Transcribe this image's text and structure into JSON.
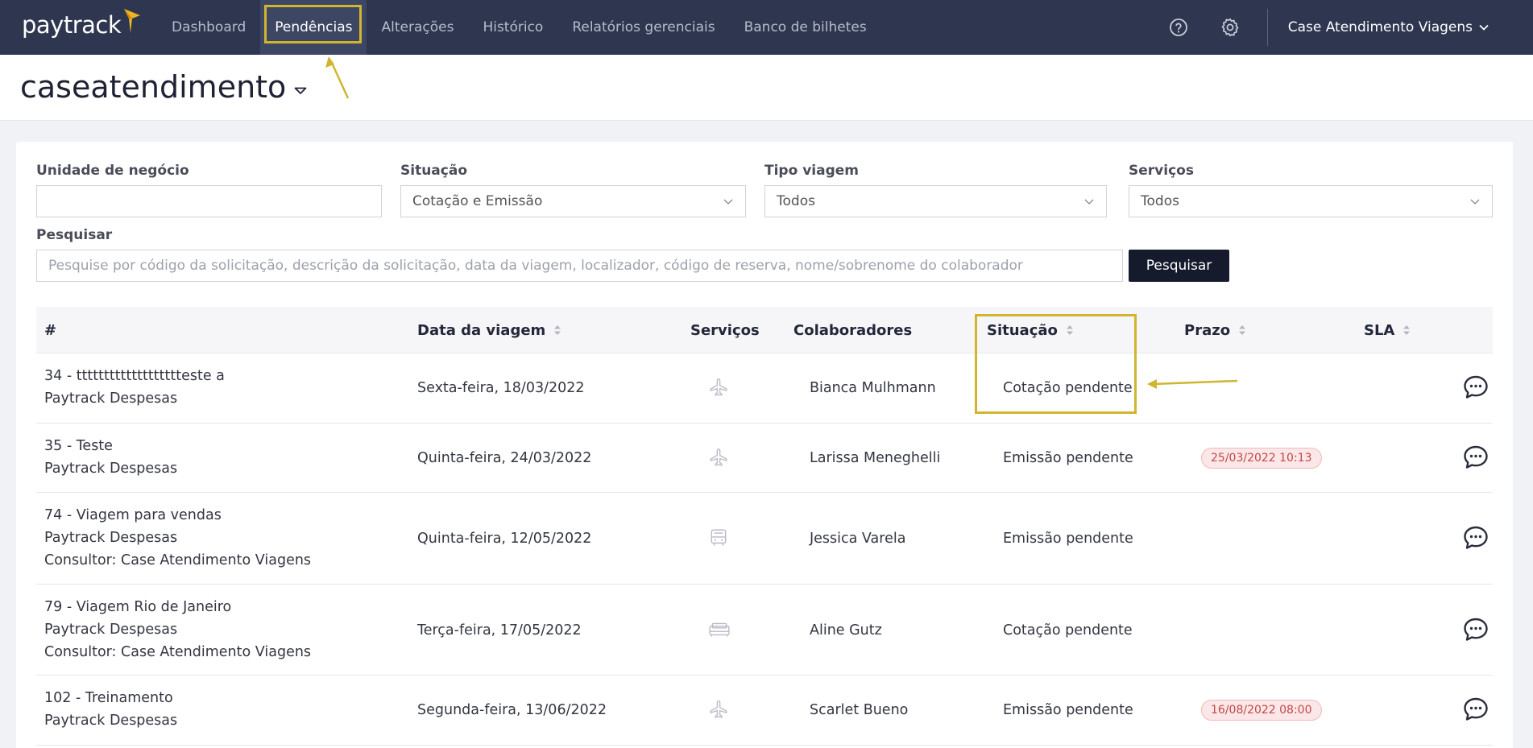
{
  "nav": {
    "logo": "paytrack",
    "items": [
      {
        "label": "Dashboard",
        "active": false
      },
      {
        "label": "Pendências",
        "active": true
      },
      {
        "label": "Alterações",
        "active": false
      },
      {
        "label": "Histórico",
        "active": false
      },
      {
        "label": "Relatórios gerenciais",
        "active": false
      },
      {
        "label": "Banco de bilhetes",
        "active": false
      }
    ],
    "help_icon": "question-circle-icon",
    "settings_icon": "gear-icon",
    "account": "Case Atendimento Viagens"
  },
  "header": {
    "title": "caseatendimento"
  },
  "filters": {
    "unidade": {
      "label": "Unidade de negócio",
      "value": ""
    },
    "situacao": {
      "label": "Situação",
      "value": "Cotação e Emissão"
    },
    "tipo": {
      "label": "Tipo viagem",
      "value": "Todos"
    },
    "servicos": {
      "label": "Serviços",
      "value": "Todos"
    },
    "pesquisar": {
      "label": "Pesquisar",
      "placeholder": "Pesquise por código da solicitação, descrição da solicitação, data da viagem, localizador, código de reserva, nome/sobrenome do colaborador",
      "button": "Pesquisar"
    }
  },
  "table": {
    "headers": {
      "num": "#",
      "data": "Data da viagem",
      "servicos": "Serviços",
      "colab": "Colaboradores",
      "situacao": "Situação",
      "prazo": "Prazo",
      "sla": "SLA"
    },
    "rows": [
      {
        "line1": "34 - ttttttttttttttttttteste a",
        "line2": "Paytrack Despesas",
        "line3": "",
        "date": "Sexta-feira, 18/03/2022",
        "service": "plane-icon",
        "colab": "Bianca Mulhmann",
        "situacao": "Cotação pendente",
        "prazo": ""
      },
      {
        "line1": "35 - Teste",
        "line2": "Paytrack Despesas",
        "line3": "",
        "date": "Quinta-feira, 24/03/2022",
        "service": "plane-icon",
        "colab": "Larissa Meneghelli",
        "situacao": "Emissão pendente",
        "prazo": "25/03/2022 10:13"
      },
      {
        "line1": "74 - Viagem para vendas",
        "line2": "Paytrack Despesas",
        "line3": "Consultor: Case Atendimento Viagens",
        "date": "Quinta-feira, 12/05/2022",
        "service": "bus-icon",
        "colab": "Jessica Varela",
        "situacao": "Emissão pendente",
        "prazo": ""
      },
      {
        "line1": "79 - Viagem Rio de Janeiro",
        "line2": "Paytrack Despesas",
        "line3": "Consultor: Case Atendimento Viagens",
        "date": "Terça-feira, 17/05/2022",
        "service": "bed-icon",
        "colab": "Aline Gutz",
        "situacao": "Cotação pendente",
        "prazo": ""
      },
      {
        "line1": "102 - Treinamento",
        "line2": "Paytrack Despesas",
        "line3": "",
        "date": "Segunda-feira, 13/06/2022",
        "service": "plane-icon",
        "colab": "Scarlet Bueno",
        "situacao": "Emissão pendente",
        "prazo": "16/08/2022 08:00"
      }
    ]
  },
  "colors": {
    "nav_bg": "#2e3650",
    "highlight": "#d0b52e",
    "button_bg": "#151a2c",
    "badge_text": "#c3474a"
  }
}
